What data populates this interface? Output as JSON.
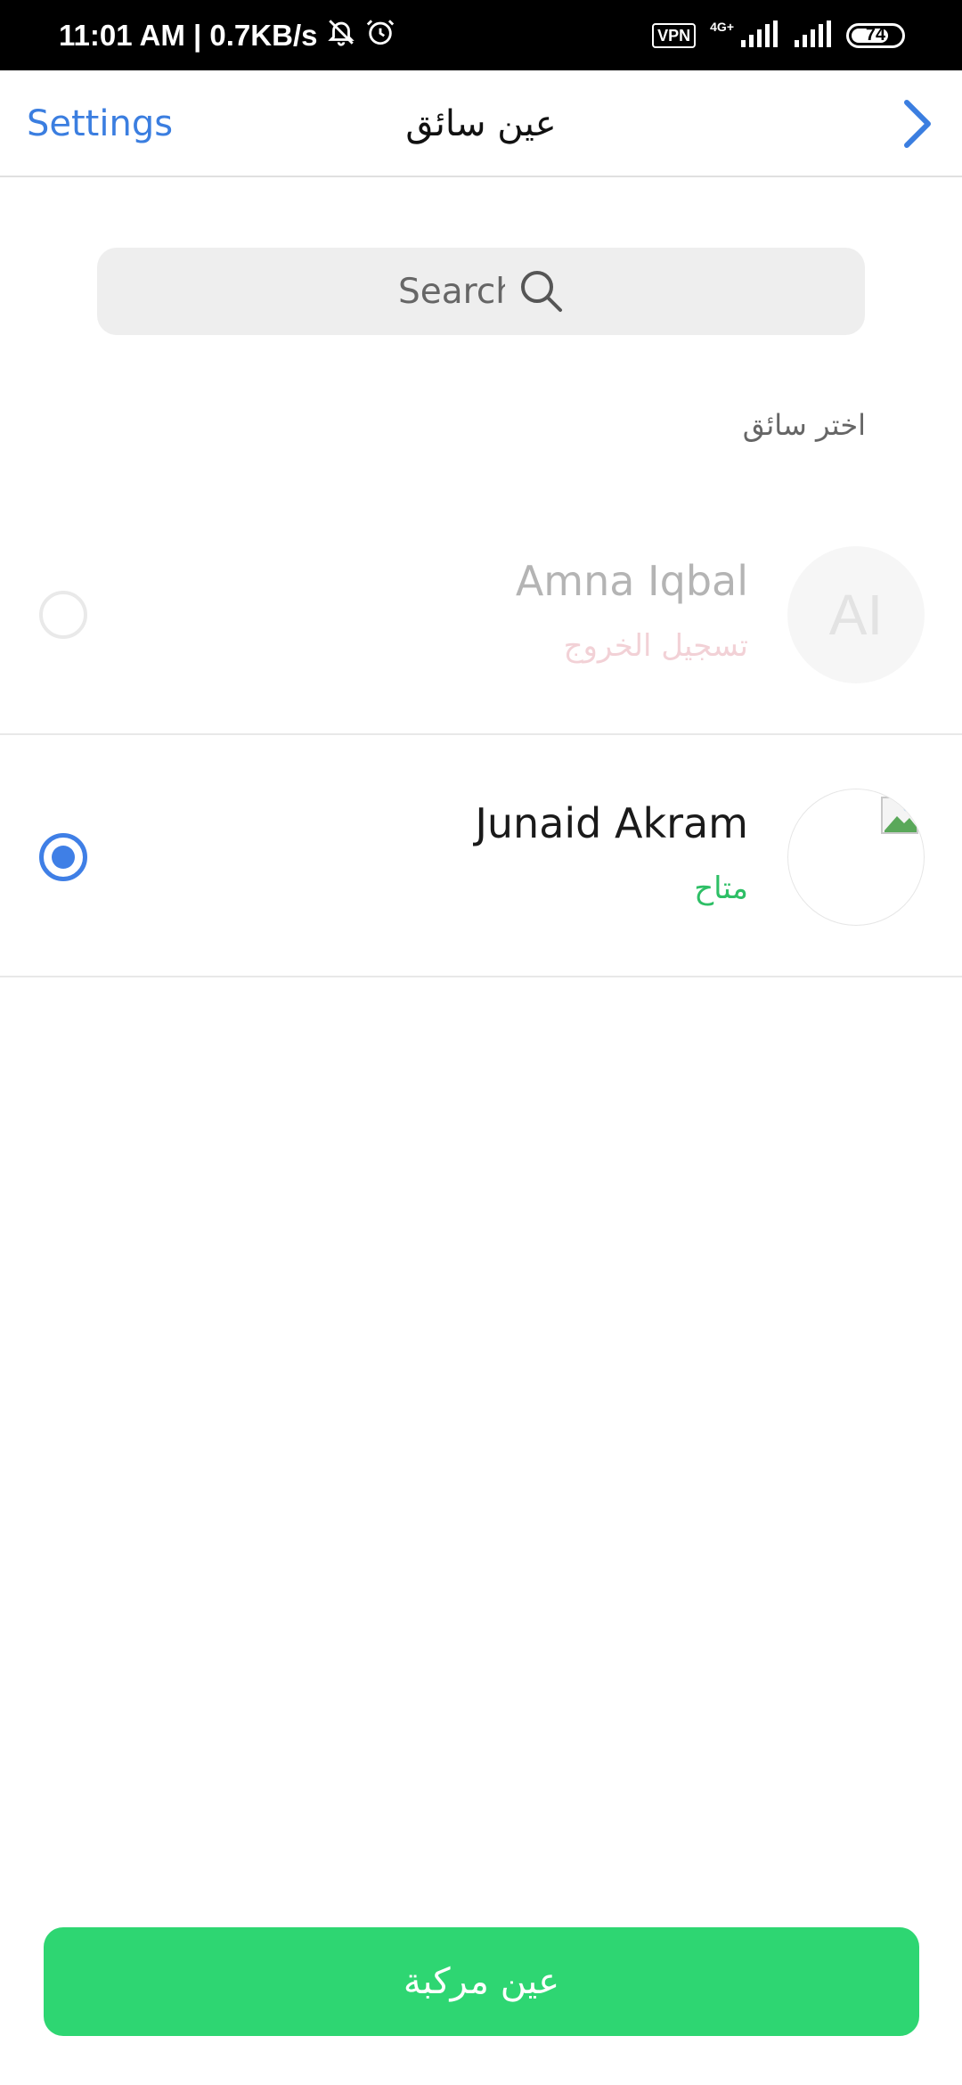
{
  "status_bar": {
    "time_speed": "11:01 AM | 0.7KB/s",
    "vpn": "VPN",
    "network": "4G+",
    "battery": "74"
  },
  "nav": {
    "back_label": "Settings",
    "title": "عين سائق"
  },
  "search": {
    "placeholder": "Search"
  },
  "section_label": "اختر سائق",
  "drivers": [
    {
      "initials": "AI",
      "name": "Amna Iqbal",
      "status": "تسجيل الخروج",
      "selected": false,
      "disabled": true
    },
    {
      "initials": "",
      "name": "Junaid Akram",
      "status": "متاح",
      "selected": true,
      "disabled": false
    }
  ],
  "primary_button": {
    "label": "عين مركبة"
  },
  "colors": {
    "accent_blue": "#3f7fe6",
    "status_available": "#2ebf66",
    "status_offline": "#e39aa6",
    "button_green": "#2ed672"
  }
}
